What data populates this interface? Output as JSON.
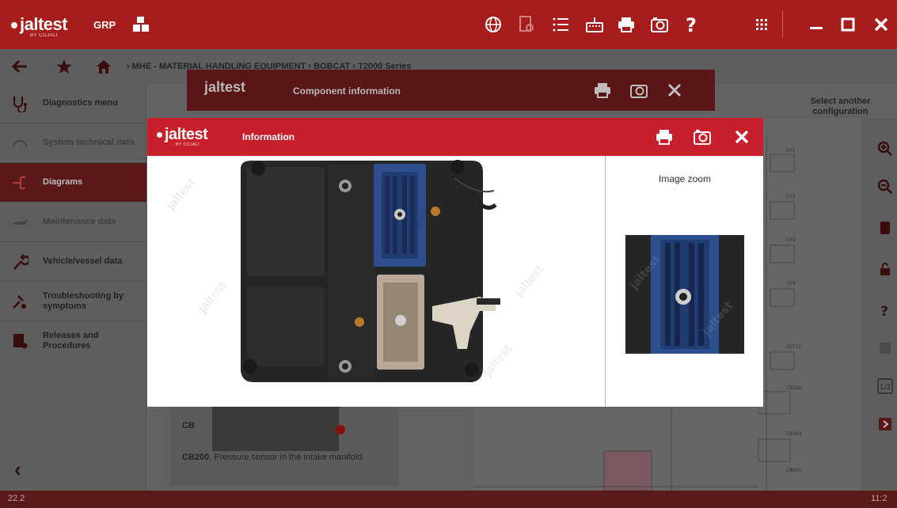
{
  "app": {
    "logo": "jaltest",
    "logo_sub": "BY COJALI",
    "module": "GRP"
  },
  "breadcrumb": {
    "path": "› MHE - MATERIAL HANDLING EQUIPMENT  ›  BOBCAT  ›  T2000 Series"
  },
  "sidebar": {
    "items": [
      {
        "label": "Diagnostics menu",
        "icon": "stethoscope-icon",
        "state": "normal"
      },
      {
        "label": "System technical data",
        "icon": "gauge-icon",
        "state": "disabled"
      },
      {
        "label": "Diagrams",
        "icon": "diagram-icon",
        "state": "active"
      },
      {
        "label": "Maintenance data",
        "icon": "oil-can-icon",
        "state": "disabled"
      },
      {
        "label": "Vehicle/vessel data",
        "icon": "wrench-icon",
        "state": "normal"
      },
      {
        "label": "Troubleshooting by symptoms",
        "icon": "troubleshoot-icon",
        "state": "normal"
      },
      {
        "label": "Releases and Procedures",
        "icon": "procedures-icon",
        "state": "normal"
      }
    ]
  },
  "main": {
    "select_config": "Select another configuration",
    "component_code": "CB",
    "component_caption_code": "CB200",
    "component_caption_text": ", Pressure sensor in the intake manifold"
  },
  "component_dialog": {
    "title": "Component information",
    "logo": "jaltest"
  },
  "modal": {
    "logo": "jaltest",
    "logo_sub": "BY COJALI",
    "title": "Information",
    "zoom_label": "Image zoom"
  },
  "status": {
    "left": "22.2",
    "right": "11:2"
  },
  "colors": {
    "brand_red": "#c8202a",
    "topbar_red": "#a81c1c",
    "connector_blue": "#2c4f8e"
  }
}
